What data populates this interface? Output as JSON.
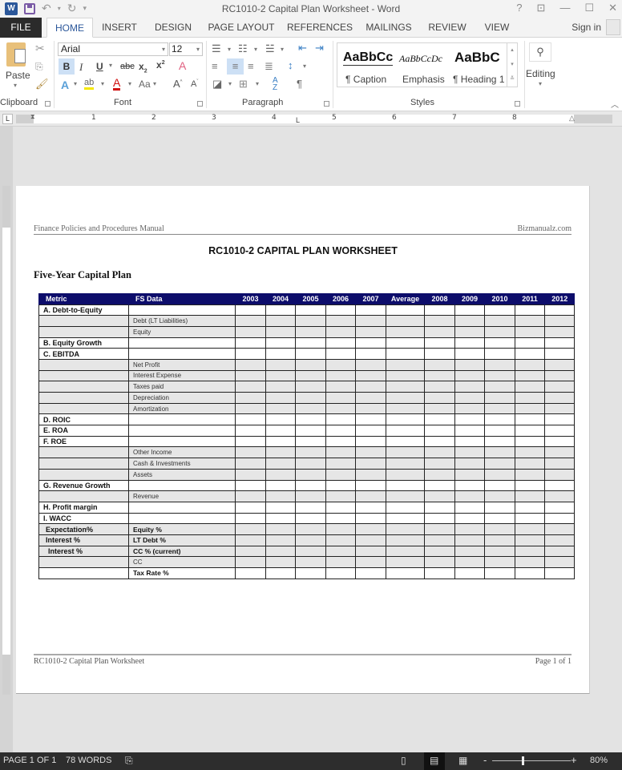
{
  "window": {
    "title": "RC1010-2 Capital Plan Worksheet - Word",
    "controls": [
      "help-icon",
      "ribbon-display-icon",
      "minimize-icon",
      "maximize-icon",
      "close-icon"
    ]
  },
  "quick_access": [
    "word-icon",
    "save-icon",
    "undo-icon",
    "redo-icon",
    "customize-icon"
  ],
  "tabs": [
    {
      "label": "FILE"
    },
    {
      "label": "HOME",
      "active": true
    },
    {
      "label": "INSERT"
    },
    {
      "label": "DESIGN"
    },
    {
      "label": "PAGE LAYOUT"
    },
    {
      "label": "REFERENCES"
    },
    {
      "label": "MAILINGS"
    },
    {
      "label": "REVIEW"
    },
    {
      "label": "VIEW"
    }
  ],
  "signin": "Sign in",
  "ribbon": {
    "clipboard": {
      "label": "Clipboard",
      "paste": "Paste"
    },
    "font": {
      "label": "Font",
      "font_name": "Arial",
      "font_size": "12",
      "change_case": "Aa"
    },
    "paragraph": {
      "label": "Paragraph"
    },
    "styles": {
      "label": "Styles",
      "items": [
        {
          "sample": "AaBbCc",
          "name": "¶ Caption"
        },
        {
          "sample": "AaBbCcDc",
          "name": "Emphasis"
        },
        {
          "sample": "AaBbC",
          "name": "¶ Heading 1"
        }
      ]
    },
    "editing": {
      "label": "Editing"
    }
  },
  "ruler": {
    "numbers": [
      "1",
      "2",
      "3",
      "4",
      "5",
      "6",
      "7",
      "8"
    ]
  },
  "document": {
    "header_left": "Finance Policies and Procedures Manual",
    "header_right": "Bizmanualz.com",
    "title": "RC1010-2 CAPITAL PLAN WORKSHEET",
    "subtitle": "Five-Year Capital Plan",
    "table": {
      "columns": [
        "Metric",
        "FS Data",
        "2003",
        "2004",
        "2005",
        "2006",
        "2007",
        "Average",
        "2008",
        "2009",
        "2010",
        "2011",
        "2012"
      ],
      "rows": [
        {
          "metric": "A. Debt-to-Equity",
          "fs": "",
          "shade": false
        },
        {
          "metric": "",
          "fs": "Debt (LT Liabilities)",
          "shade": true
        },
        {
          "metric": "",
          "fs": "Equity",
          "shade": true
        },
        {
          "metric": "B. Equity Growth",
          "fs": "",
          "shade": false
        },
        {
          "metric": "C. EBITDA",
          "fs": "",
          "shade": false
        },
        {
          "metric": "",
          "fs": "Net Profit",
          "shade": true
        },
        {
          "metric": "",
          "fs": "Interest Expense",
          "shade": true
        },
        {
          "metric": "",
          "fs": "Taxes paid",
          "shade": true
        },
        {
          "metric": "",
          "fs": "Depreciation",
          "shade": true
        },
        {
          "metric": "",
          "fs": "Amortization",
          "shade": true
        },
        {
          "metric": "D. ROIC",
          "fs": "",
          "shade": false
        },
        {
          "metric": "E. ROA",
          "fs": "",
          "shade": false
        },
        {
          "metric": "F. ROE",
          "fs": "",
          "shade": false
        },
        {
          "metric": "",
          "fs": "Other Income",
          "shade": true
        },
        {
          "metric": "",
          "fs": "Cash & Investments",
          "shade": true
        },
        {
          "metric": "",
          "fs": "Assets",
          "shade": true
        },
        {
          "metric": "G. Revenue Growth",
          "fs": "",
          "shade": false
        },
        {
          "metric": "",
          "fs": "Revenue",
          "shade": true
        },
        {
          "metric": "H. Profit margin",
          "fs": "",
          "shade": false
        },
        {
          "metric": "I. WACC",
          "fs": "",
          "shade": false
        },
        {
          "metric": "Expectation%",
          "fs": "Equity %",
          "shade": true,
          "bold_fs": true,
          "indent": 1
        },
        {
          "metric": "Interest %",
          "fs": "LT Debt %",
          "shade": true,
          "bold_fs": true,
          "indent": 1
        },
        {
          "metric": "Interest %",
          "fs": "CC % (current)",
          "shade": true,
          "bold_fs": true,
          "indent": 2
        },
        {
          "metric": "",
          "fs": "CC",
          "shade": true
        },
        {
          "metric": "",
          "fs": "Tax Rate %",
          "shade": false,
          "bold_fs": true
        }
      ]
    },
    "footer_left": "RC1010-2 Capital Plan Worksheet",
    "footer_right": "Page 1 of 1"
  },
  "status": {
    "page": "PAGE 1 OF 1",
    "words": "78 WORDS",
    "zoom": "80%",
    "zoom_percent": 80
  },
  "colors": {
    "table_header": "#0d0d6b",
    "row_shade": "#e6e6e6",
    "word_blue": "#2b579a"
  }
}
